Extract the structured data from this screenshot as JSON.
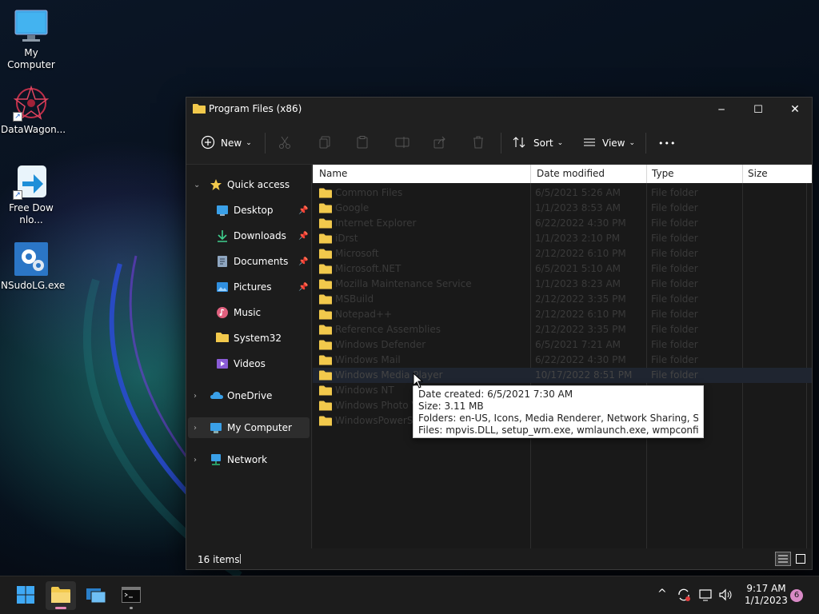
{
  "desktop": {
    "icons": [
      {
        "label": "My Computer"
      },
      {
        "label": "DataWagon..."
      },
      {
        "label": "Free Downlo..."
      },
      {
        "label": "NSudoLG.exe"
      }
    ]
  },
  "window": {
    "title": "Program Files (x86)",
    "controls": {
      "minimize": "─",
      "maximize": "☐",
      "close": "✕"
    }
  },
  "toolbar": {
    "new_label": "New",
    "sort_label": "Sort",
    "view_label": "View",
    "more_label": "•••"
  },
  "nav": {
    "items": [
      {
        "label": "Quick access",
        "chevron": "⌄"
      },
      {
        "label": "Desktop"
      },
      {
        "label": "Downloads"
      },
      {
        "label": "Documents"
      },
      {
        "label": "Pictures"
      },
      {
        "label": "Music"
      },
      {
        "label": "System32"
      },
      {
        "label": "Videos"
      },
      {
        "label": "OneDrive",
        "chevron": "›"
      },
      {
        "label": "My Computer",
        "chevron": "›"
      },
      {
        "label": "Network",
        "chevron": "›"
      }
    ]
  },
  "columns": {
    "name": "Name",
    "date": "Date modified",
    "type": "Type",
    "size": "Size"
  },
  "files": [
    {
      "name": "Common Files",
      "date": "6/5/2021 5:26 AM",
      "type": "File folder"
    },
    {
      "name": "Google",
      "date": "1/1/2023 8:53 AM",
      "type": "File folder"
    },
    {
      "name": "Internet Explorer",
      "date": "6/22/2022 4:30 PM",
      "type": "File folder"
    },
    {
      "name": "iDrst",
      "date": "1/1/2023 2:10 PM",
      "type": "File folder"
    },
    {
      "name": "Microsoft",
      "date": "2/12/2022 6:10 PM",
      "type": "File folder"
    },
    {
      "name": "Microsoft.NET",
      "date": "6/5/2021 5:10 AM",
      "type": "File folder"
    },
    {
      "name": "Mozilla Maintenance Service",
      "date": "1/1/2023 8:23 AM",
      "type": "File folder"
    },
    {
      "name": "MSBuild",
      "date": "2/12/2022 3:35 PM",
      "type": "File folder"
    },
    {
      "name": "Notepad++",
      "date": "2/12/2022 6:10 PM",
      "type": "File folder"
    },
    {
      "name": "Reference Assemblies",
      "date": "2/12/2022 3:35 PM",
      "type": "File folder"
    },
    {
      "name": "Windows Defender",
      "date": "6/5/2021 7:21 AM",
      "type": "File folder"
    },
    {
      "name": "Windows Mail",
      "date": "6/22/2022 4:30 PM",
      "type": "File folder"
    },
    {
      "name": "Windows Media Player",
      "date": "10/17/2022 8:51 PM",
      "type": "File folder"
    },
    {
      "name": "Windows NT",
      "date": "",
      "type": ""
    },
    {
      "name": "Windows Photo Viewer",
      "date": "",
      "type": ""
    },
    {
      "name": "WindowsPowerShell",
      "date": "",
      "type": ""
    }
  ],
  "tooltip": {
    "created": "Date created: 6/5/2021 7:30 AM",
    "size": "Size: 3.11 MB",
    "folders": "Folders: en-US, Icons, Media Renderer, Network Sharing, Skins, ...",
    "files": "Files: mpvis.DLL, setup_wm.exe, wmlaunch.exe, wmpconfig.exe, ..."
  },
  "status": {
    "count": "16 items"
  },
  "taskbar": {
    "time": "9:17 AM",
    "date": "1/1/2023",
    "notifications": "6"
  },
  "colors": {
    "accent": "#0078d4",
    "folder": "#f2c94c",
    "window_bg": "#1c1c1c"
  }
}
